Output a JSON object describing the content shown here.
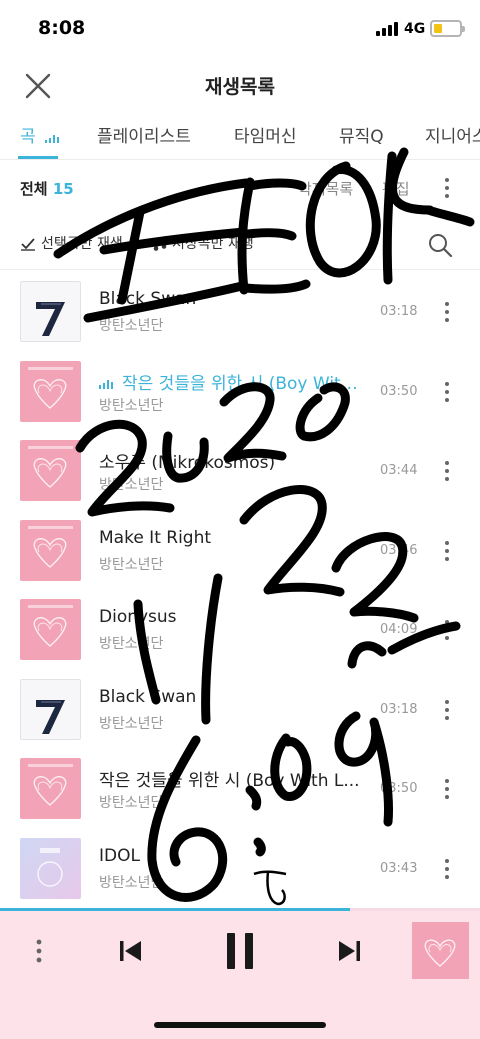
{
  "status_bar": {
    "time": "8:08",
    "network": "4G"
  },
  "header": {
    "title": "재생목록"
  },
  "tabs": [
    {
      "label": "곡",
      "active": true
    },
    {
      "label": "플레이리스트",
      "active": false
    },
    {
      "label": "타임머신",
      "active": false
    },
    {
      "label": "뮤직Q",
      "active": false
    },
    {
      "label": "지니어스",
      "active": false
    }
  ],
  "summary": {
    "label": "전체",
    "count": "15",
    "delete_label": "삭제목록",
    "edit_label": "편집"
  },
  "filters": {
    "selected_play": "선택곡만 재생",
    "saved_play": "저장곡만 재생"
  },
  "songs": [
    {
      "title": "Black Swan",
      "artist": "방탄소년단",
      "duration": "03:18",
      "art": "7",
      "playing": false
    },
    {
      "title": "작은 것들을 위한 시 (Boy With Luv)",
      "artist": "방탄소년단",
      "duration": "03:50",
      "art": "heart",
      "playing": true
    },
    {
      "title": "소우주 (Mikrokosmos)",
      "artist": "방탄소년단",
      "duration": "03:44",
      "art": "heart",
      "playing": false
    },
    {
      "title": "Make It Right",
      "artist": "방탄소년단",
      "duration": "03:46",
      "art": "heart",
      "playing": false
    },
    {
      "title": "Dionysus",
      "artist": "방탄소년단",
      "duration": "04:09",
      "art": "heart",
      "playing": false
    },
    {
      "title": "Black Swan",
      "artist": "방탄소년단",
      "duration": "03:18",
      "art": "7",
      "playing": false
    },
    {
      "title": "작은 것들을 위한 시 (Boy With L...",
      "artist": "방탄소년단",
      "duration": "03:50",
      "art": "heart",
      "playing": false
    },
    {
      "title": "IDOL",
      "artist": "방탄소년단",
      "duration": "03:43",
      "art": "love-yourself",
      "playing": false
    }
  ],
  "playback": {
    "progress": 0.73
  },
  "colors": {
    "accent": "#3cb4d9",
    "player_bg": "#fde2ea",
    "album_pink": "#f2a3b6",
    "scribble": "#000000"
  },
  "icons": [
    "close-icon",
    "equalizer-icon",
    "more-icon",
    "check-icon",
    "music-note-icon",
    "search-icon",
    "previous-icon",
    "pause-icon",
    "next-icon"
  ]
}
